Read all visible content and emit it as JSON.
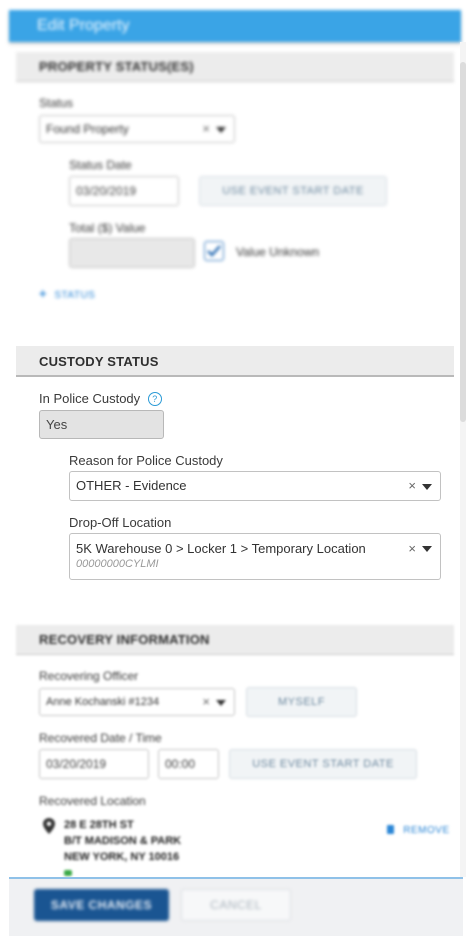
{
  "dialog": {
    "title": "Edit Property"
  },
  "property_status": {
    "header": "PROPERTY STATUS(ES)",
    "status_label": "Status",
    "status_value": "Found Property",
    "status_date_label": "Status Date",
    "status_date_value": "03/20/2019",
    "use_event_start_date": "USE EVENT START DATE",
    "total_value_label": "Total ($) Value",
    "total_value_value": "",
    "value_unknown_label": "Value Unknown",
    "value_unknown_checked": true,
    "add_status": "STATUS"
  },
  "custody": {
    "header": "CUSTODY STATUS",
    "in_police_custody_label": "In Police Custody",
    "in_police_custody_value": "Yes",
    "reason_label": "Reason for Police Custody",
    "reason_value": "OTHER - Evidence",
    "dropoff_label": "Drop-Off Location",
    "dropoff_value": "5K Warehouse 0 > Locker 1 > Temporary Location",
    "dropoff_code": "00000000CYLMI"
  },
  "recovery": {
    "header": "RECOVERY INFORMATION",
    "officer_label": "Recovering Officer",
    "officer_value": "Anne Kochanski #1234",
    "myself": "MYSELF",
    "date_time_label": "Recovered Date / Time",
    "date_value": "03/20/2019",
    "time_value": "00:00",
    "use_event_start_date": "USE EVENT START DATE",
    "location_label": "Recovered Location",
    "address_line1": "28 E 28TH ST",
    "address_line2": "B/T MADISON & PARK",
    "address_line3": "NEW YORK, NY 10016",
    "remove": "REMOVE"
  },
  "footer": {
    "save": "SAVE CHANGES",
    "cancel": "CANCEL"
  },
  "colors": {
    "title_bar": "#3aa4e6",
    "primary_button": "#1a5592",
    "link": "#2a86d6"
  }
}
